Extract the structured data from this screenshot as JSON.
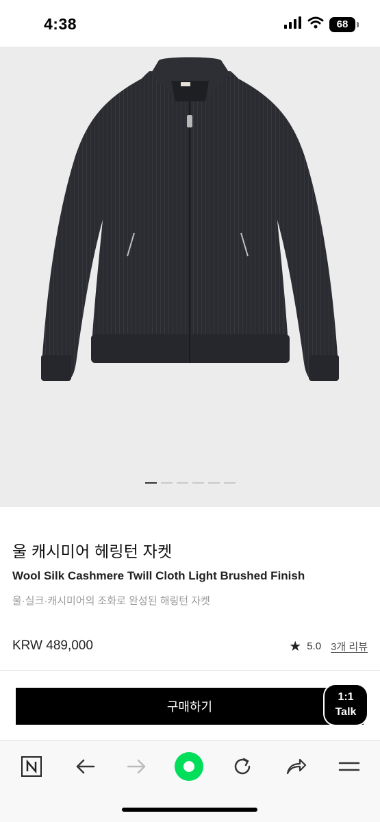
{
  "status_bar": {
    "time": "4:38",
    "battery_level": "68",
    "icons": [
      "signal-icon",
      "wifi-icon",
      "battery-icon"
    ]
  },
  "gallery": {
    "image_count": 6,
    "active_index": 0
  },
  "product": {
    "title_ko": "울 캐시미어 헤링턴 자켓",
    "title_en": "Wool Silk Cashmere Twill Cloth Light Brushed Finish",
    "description": "울·실크·캐시미어의 조화로 완성된 해링턴 자켓",
    "price": "KRW 489,000",
    "rating": "5.0",
    "review_count_label": "3개 리뷰"
  },
  "actions": {
    "buy_label": "구매하기",
    "talk_line1": "1:1",
    "talk_line2": "Talk"
  },
  "browser_bar": {
    "items": [
      "naver-n-icon",
      "back-arrow-icon",
      "forward-arrow-icon",
      "green-dot-icon",
      "refresh-icon",
      "share-icon",
      "menu-icon"
    ],
    "accent_color": "#00de5a"
  },
  "colors": {
    "image_background": "#ececec",
    "button": "#000000",
    "jacket": "#2b2c31"
  }
}
